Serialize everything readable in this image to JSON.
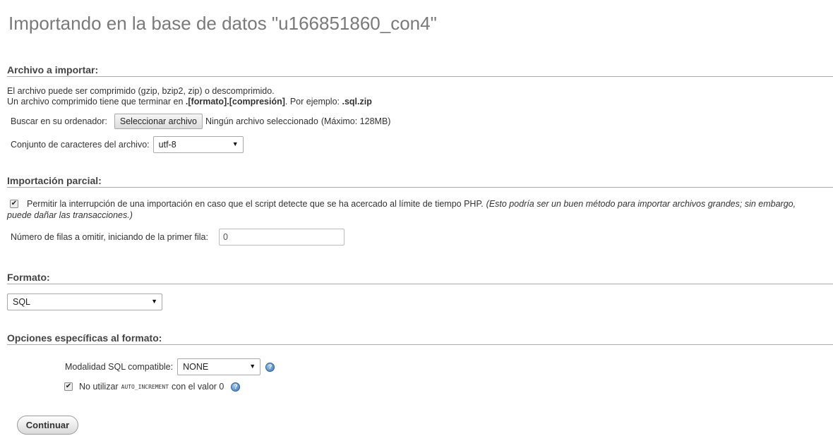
{
  "title": "Importando en la base de datos \"u166851860_con4\"",
  "file_section": {
    "heading": "Archivo a importar:",
    "line1": "El archivo puede ser comprimido (gzip, bzip2, zip) o descomprimido.",
    "line2_prefix": "Un archivo comprimido tiene que terminar en ",
    "line2_format": ".[formato].[compresión]",
    "line2_middle": ". Por ejemplo: ",
    "line2_example": ".sql.zip",
    "browse_label": "Buscar en su ordenador:",
    "browse_button": "Seleccionar archivo",
    "no_file": "Ningún archivo seleccionado",
    "max_size": "(Máximo: 128MB)",
    "charset_label": "Conjunto de caracteres del archivo:",
    "charset_value": "utf-8"
  },
  "partial_section": {
    "heading": "Importación parcial:",
    "allow_interrupt_checked": true,
    "allow_interrupt_text": "Permitir la interrupción de una importación en caso que el script detecte que se ha acercado al límite de tiempo PHP.",
    "allow_interrupt_note_1": "(Esto podría ser un buen método para importar archivos grandes; sin embargo,",
    "allow_interrupt_note_2": "puede dañar las transacciones.)",
    "skip_rows_label": "Número de filas a omitir, iniciando de la primer fila:",
    "skip_rows_value": "0"
  },
  "format_section": {
    "heading": "Formato:",
    "format_value": "SQL"
  },
  "options_section": {
    "heading": "Opciones específicas al formato:",
    "sql_compat_label": "Modalidad SQL compatible:",
    "sql_compat_value": "NONE",
    "no_auto_inc_checked": true,
    "no_auto_inc_prefix": "No utilizar",
    "no_auto_inc_code": "AUTO_INCREMENT",
    "no_auto_inc_suffix": "con el valor 0"
  },
  "continue_button": "Continuar",
  "icons": {
    "help": "help-icon",
    "dropdown": "chevron-down-icon",
    "check": "checkmark-icon"
  }
}
